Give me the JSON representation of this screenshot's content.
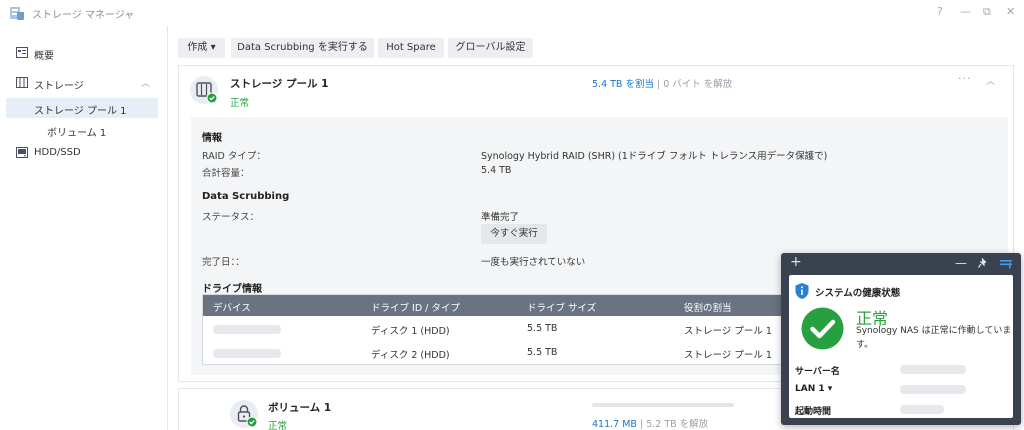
{
  "window": {
    "title": "ストレージ マネージャ",
    "controls": {
      "help": "?",
      "minimize": "—",
      "restore": "⧉",
      "close": "✕"
    }
  },
  "sidebar": {
    "items": [
      {
        "label": "概要",
        "icon": "overview-icon"
      },
      {
        "label": "ストレージ",
        "icon": "storage-icon",
        "expanded": true
      },
      {
        "label": "ストレージ プール 1",
        "selected": true
      },
      {
        "label": "ボリューム 1"
      },
      {
        "label": "HDD/SSD",
        "icon": "hdd-icon"
      }
    ]
  },
  "toolbar": {
    "create_label": "作成 ▾",
    "scrub_label": "Data Scrubbing を実行する",
    "hotspare_label": "Hot Spare",
    "global_label": "グローバル設定"
  },
  "pool": {
    "title": "ストレージ プール 1",
    "status": "正常",
    "allocated": "5.4 TB を割当",
    "separator": " | ",
    "free": "0 バイト を解放",
    "more": "···",
    "info_heading": "情報",
    "raid_label": "RAID タイプ：",
    "raid_value": "Synology Hybrid RAID (SHR) (1ドライブ フォルト トレランス用データ保護で)",
    "capacity_label": "合計容量：",
    "capacity_value": "5.4 TB",
    "scrub_heading": "Data Scrubbing",
    "scrub_status_label": "ステータス：",
    "scrub_status_value": "準備完了",
    "run_now_label": "今すぐ実行",
    "completed_label": "完了日：：",
    "completed_value": "一度も実行されていない",
    "drive_heading": "ドライブ情報",
    "drive_columns": [
      "デバイス",
      "ドライブ ID / タイプ",
      "ドライブ サイズ",
      "役割の割当"
    ],
    "drives": [
      {
        "id": "ディスク 1 (HDD)",
        "size": "5.5 TB",
        "role": "ストレージ プール 1"
      },
      {
        "id": "ディスク 2 (HDD)",
        "size": "5.5 TB",
        "role": "ストレージ プール 1"
      }
    ]
  },
  "volume": {
    "title": "ボリューム 1",
    "status": "正常",
    "used": "411.7 MB",
    "separator": " | ",
    "free": "5.2 TB を解放",
    "usage_fraction": 0.0
  },
  "health_widget": {
    "title": "システムの健康状態",
    "status": "正常",
    "description": "Synology NAS は正常に作動しています。",
    "server_name_label": "サーバー名",
    "lan_label": "LAN 1 ▾",
    "uptime_label": "起動時間",
    "add": "+",
    "minimize": "—",
    "pin": "📌",
    "settings": "≡"
  },
  "colors": {
    "ok_green": "#27a03f",
    "link_blue": "#1a74c9",
    "table_header": "#6b7380",
    "widget_frame": "#3a4250"
  }
}
